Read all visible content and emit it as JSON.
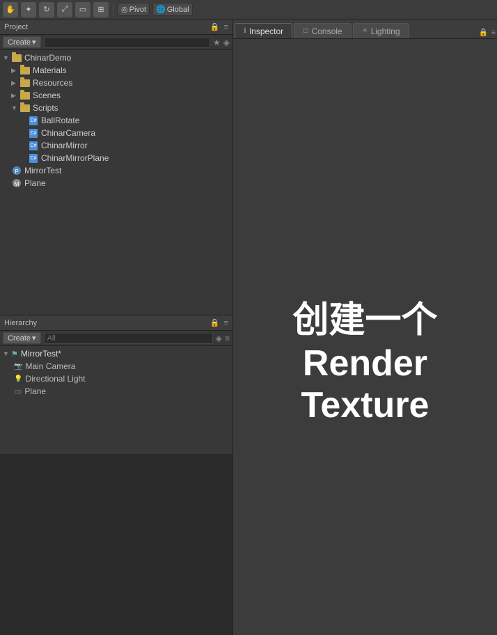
{
  "toolbar": {
    "tools": [
      "hand",
      "move",
      "rotate",
      "scale",
      "rect",
      "transform"
    ],
    "pivot_label": "Pivot",
    "global_label": "Global"
  },
  "project_panel": {
    "title": "Project",
    "create_label": "Create",
    "search_placeholder": "",
    "tree": [
      {
        "type": "folder",
        "label": "ChinarDemo",
        "depth": 0,
        "expanded": true
      },
      {
        "type": "folder",
        "label": "Materials",
        "depth": 1,
        "expanded": false
      },
      {
        "type": "folder",
        "label": "Resources",
        "depth": 1,
        "expanded": false
      },
      {
        "type": "folder",
        "label": "Scenes",
        "depth": 1,
        "expanded": false
      },
      {
        "type": "folder",
        "label": "Scripts",
        "depth": 1,
        "expanded": true
      },
      {
        "type": "script",
        "label": "BallRotate",
        "depth": 2
      },
      {
        "type": "script",
        "label": "ChinarCamera",
        "depth": 2
      },
      {
        "type": "script",
        "label": "ChinarMirror",
        "depth": 2
      },
      {
        "type": "script",
        "label": "ChinarMirrorPlane",
        "depth": 2
      },
      {
        "type": "prefab",
        "label": "MirrorTest",
        "depth": 0
      },
      {
        "type": "mesh",
        "label": "Plane",
        "depth": 0
      }
    ]
  },
  "hierarchy_panel": {
    "title": "Hierarchy",
    "create_label": "Create",
    "search_placeholder": "All",
    "scene": "MirrorTest*",
    "items": [
      {
        "label": "Main Camera",
        "type": "camera"
      },
      {
        "label": "Directional Light",
        "type": "light"
      },
      {
        "label": "Plane",
        "type": "mesh"
      }
    ]
  },
  "tabs": {
    "inspector": {
      "label": "Inspector",
      "active": true
    },
    "console": {
      "label": "Console",
      "active": false
    },
    "lighting": {
      "label": "Lighting",
      "active": false
    }
  },
  "main_text": "创建一个Render Texture"
}
